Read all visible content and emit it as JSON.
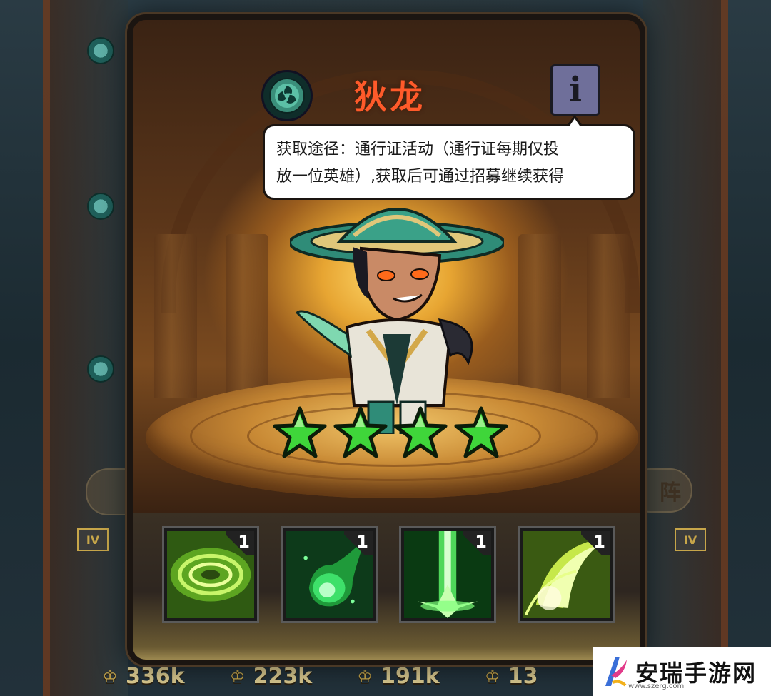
{
  "hero": {
    "name": "狄龙",
    "element_icon": "wind-element-icon",
    "star_count": 4,
    "star_color": "#3fd63a"
  },
  "info_button": {
    "label": "i",
    "icon": "info-icon"
  },
  "tooltip": {
    "line1": "获取途径：通行证活动（通行证每期仅投",
    "line2": "放一位英雄）,获取后可通过招募继续获得"
  },
  "skills": [
    {
      "icon": "green-vortex-icon",
      "level": "1"
    },
    {
      "icon": "green-fireball-icon",
      "level": "1"
    },
    {
      "icon": "green-light-beam-icon",
      "level": "1"
    },
    {
      "icon": "green-crescent-slash-icon",
      "level": "1"
    }
  ],
  "background": {
    "right_button_label": "阵",
    "level_tag": "IV",
    "powers": [
      "336k",
      "223k",
      "191k",
      "13"
    ]
  },
  "watermark": {
    "text": "安瑞手游网",
    "url": "www.szerg.com"
  },
  "colors": {
    "hero_name": "#ff5a2a",
    "accent_gold": "#c7a64a",
    "skill_green": "#5fe03a"
  }
}
